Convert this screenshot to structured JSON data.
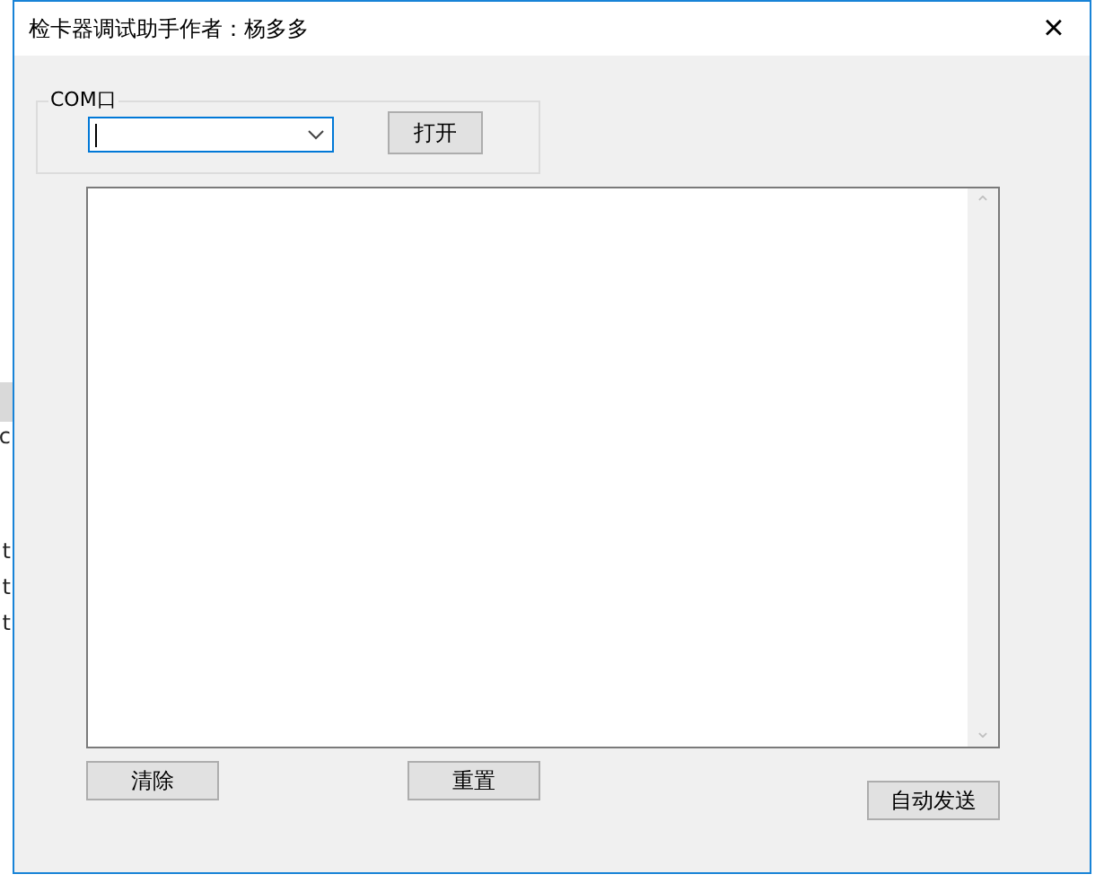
{
  "background_window": {
    "fragments": [
      {
        "kind": "highlight"
      },
      {
        "kind": "text",
        "text": "c"
      },
      {
        "kind": "text",
        "text": "t"
      },
      {
        "kind": "text",
        "text": "t"
      },
      {
        "kind": "text",
        "text": "t"
      }
    ]
  },
  "window": {
    "title": "检卡器调试助手作者：杨多多",
    "close": "×"
  },
  "com_group": {
    "label": "COM口",
    "port_focused": true,
    "open_button": "打开"
  },
  "output": {
    "scrollbar_up": "⌃",
    "scrollbar_down": "⌄"
  },
  "buttons": [
    {
      "kind": "clear",
      "label": "清除"
    },
    {
      "kind": "reset",
      "label": "重置"
    },
    {
      "kind": "auto",
      "label": "自动发送"
    }
  ]
}
